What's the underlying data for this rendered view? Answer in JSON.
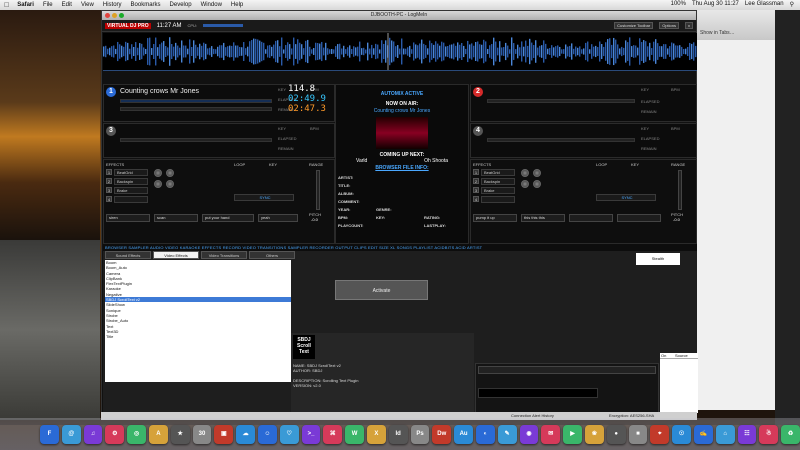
{
  "menubar": {
    "items": [
      "Safari",
      "File",
      "Edit",
      "View",
      "History",
      "Bookmarks",
      "Develop",
      "Window",
      "Help"
    ],
    "clock": "Thu Aug 30  11:27",
    "user": "Lee Glassman",
    "battery": "100%"
  },
  "window": {
    "title": "DJBOOTH-PC - LogMeIn"
  },
  "toolbar": {
    "logo": "VIRTUAL DJ PRO",
    "clock": "11:27 AM",
    "cpu": "CPU:",
    "customize": "Customize Toolbar",
    "options": "Options",
    "close": "x"
  },
  "safari": {
    "show_in_tab": "Show in Tabs…"
  },
  "deck1": {
    "number": "1",
    "title": "Counting crows   Mr Jones",
    "key": "KEY",
    "bpm_label": "BPM",
    "time_elapsed": "02:49.9",
    "time_remain": "02:47.3",
    "bpm": "114.8",
    "elapsed_label": "ELAPSED",
    "remain_label": "REMAIN"
  },
  "deck2": {
    "number": "2",
    "key": "KEY",
    "bpm_label": "BPM",
    "elapsed_label": "ELAPSED",
    "remain_label": "REMAIN"
  },
  "deck3": {
    "number": "3",
    "key": "KEY",
    "bpm_label": "BPM",
    "elapsed_label": "ELAPSED",
    "remain_label": "REMAIN"
  },
  "deck4": {
    "number": "4",
    "key": "KEY",
    "bpm_label": "BPM",
    "elapsed_label": "ELAPSED",
    "remain_label": "REMAIN"
  },
  "center": {
    "automix": "AUTOMIX ACTIVE",
    "now_on_air": "NOW ON AIR:",
    "now_title": "Counting crows   Mr Jones",
    "coming_up": "COMING UP NEXT:",
    "next_artist": "Varld",
    "next_title": "Oh Shoota",
    "browser_info": "BROWSER FILE INFO:",
    "fields": [
      "ARTIST:",
      "TITLE:",
      "ALBUM:",
      "COMMENT:",
      "YEAR:",
      "BPM:",
      "PLAYCOUNT:"
    ],
    "genre": "GENRE:",
    "key": "KEY:",
    "rating": "RATING:",
    "lastplay": "LASTPLAY:"
  },
  "controls_left": {
    "effects": "EFFECTS",
    "fxlist": [
      "BeatGrid",
      "Backspin",
      "Brake",
      ""
    ],
    "fx_nums": [
      "1",
      "2",
      "3",
      "4"
    ],
    "loop": "LOOP",
    "key": "KEY",
    "range": "RANGE",
    "pitch": "PITCH",
    "pitch_val": "-0.0",
    "hotcues": [
      "siren",
      "scan",
      "put your hand",
      "yeah"
    ],
    "sync": "SYNC"
  },
  "controls_right": {
    "effects": "EFFECTS",
    "fxlist": [
      "BeatGrid",
      "Backspin",
      "Brake",
      ""
    ],
    "fx_nums": [
      "1",
      "2",
      "3",
      "4"
    ],
    "loop": "LOOP",
    "key": "KEY",
    "range": "RANGE",
    "pitch": "PITCH",
    "pitch_val": "-0.0",
    "hotcues": [
      "pump it up",
      "this this this",
      "",
      ""
    ],
    "sync": "SYNC"
  },
  "tabsrow": "BROWSER  SAMPLER  AUDIO  VIDEO  KARAOKE  EFFECTS  RECORD  VIDEO  TRANSITIONS  SAMPLER  RECORDER  OUTPUT  CLIPS  EDIT  SIZE  XL  SONGS  PLAYLIST  ACIDBITS  ACID  ARTIST",
  "browser": {
    "tabs": [
      "Sound Effects",
      "Video Effects",
      "Video Transitions",
      "Others"
    ],
    "plugins": [
      "Boom",
      "Boom_Auto",
      "Camera",
      "ClipBank",
      "FlexTextPlugin",
      "Karaoke",
      "Negative",
      "SBDJ ScrollText v2",
      "SlideShow",
      "Sonique",
      "Strobe",
      "Strobe_Auto",
      "Text",
      "Text3D",
      "Title"
    ],
    "activate": "Activate",
    "stealth": "Stealth",
    "info_logo": "SBDJ Scroll Text",
    "info_name": "NAME: SBDJ ScrollText v2",
    "info_author": "AUTHOR: SBDJ",
    "info_desc": "DESCRIPTION: Scrolling Text Plugin",
    "info_version": "VERSION: v2.0",
    "rating_cols": [
      "On",
      "Source"
    ]
  },
  "status": {
    "history": "Connection Alert History",
    "encryption": "Encryption: AES256-SHA"
  },
  "dock": {
    "apps": [
      "F",
      "@",
      "♫",
      "⚙",
      "◎",
      "A",
      "★",
      "30",
      "▣",
      "☁",
      "☺",
      "♡",
      ">_",
      "⌘",
      "W",
      "X",
      "Id",
      "Ps",
      "Dw",
      "Au",
      "◐",
      "✎",
      "◉",
      "✉",
      "▶",
      "❀",
      "●",
      "■",
      "⌖",
      "☉",
      "✍",
      "⌂",
      "☷",
      "☃",
      "♻"
    ]
  },
  "colors": {
    "accent": "#4aa8ff",
    "deck1": "#2a6ad6",
    "deck2": "#d62a2a",
    "selection": "#3d7ad6"
  }
}
